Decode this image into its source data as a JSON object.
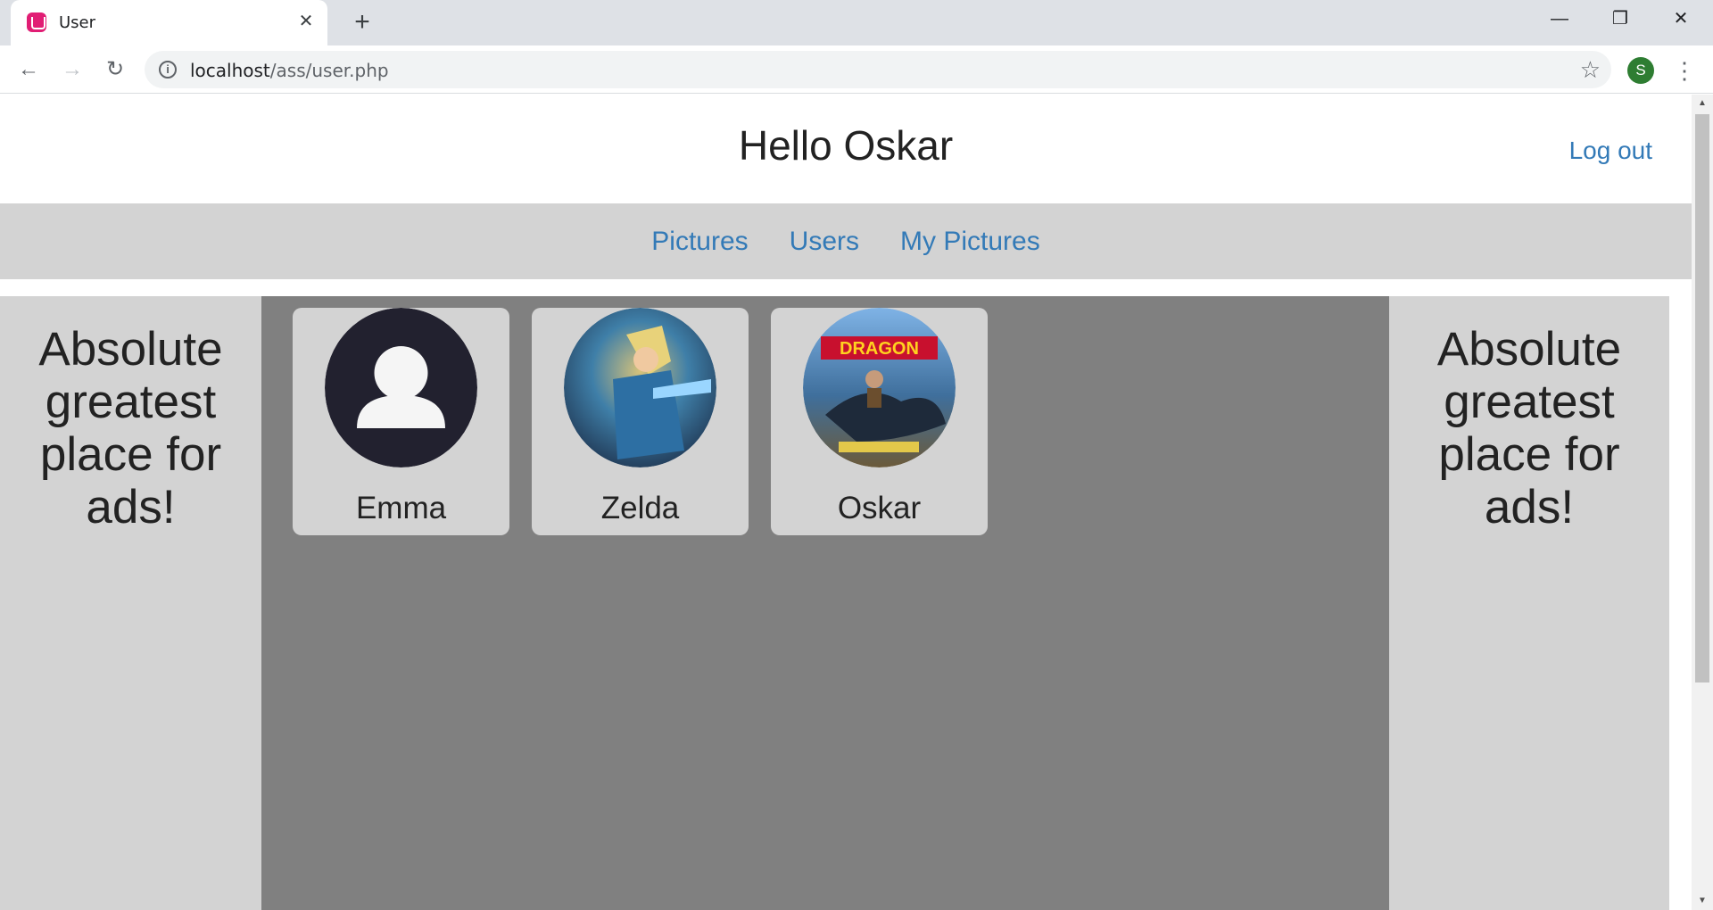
{
  "browser": {
    "tab_title": "User",
    "url_host": "localhost",
    "url_path": "/ass/user.php",
    "profile_initial": "S"
  },
  "page": {
    "greeting": "Hello Oskar",
    "logout_label": "Log out",
    "nav": [
      "Pictures",
      "Users",
      "My Pictures"
    ],
    "ad_text": "Absolute greatest place for ads!",
    "users": [
      {
        "name": "Emma",
        "avatar": "default-user-icon"
      },
      {
        "name": "Zelda",
        "avatar": "zelda-character-image"
      },
      {
        "name": "Oskar",
        "avatar": "how-to-train-your-dragon-image"
      }
    ]
  },
  "colors": {
    "link": "#337ab7",
    "nav_bg": "#d3d3d3",
    "content_bg": "#808080",
    "avatar_dark": "#22212f"
  }
}
